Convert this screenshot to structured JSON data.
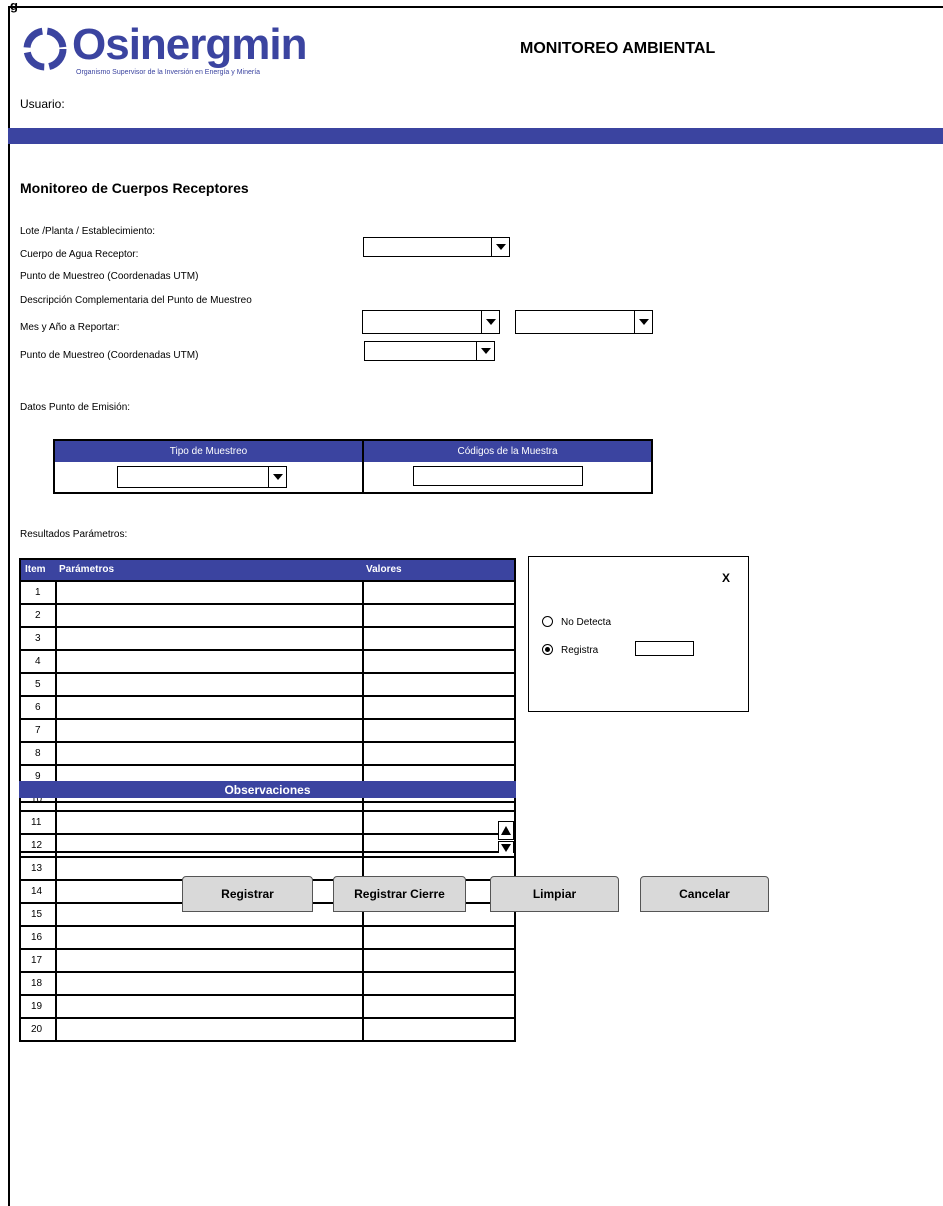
{
  "header": {
    "corner_text": "g",
    "logo_name": "Osinergmin",
    "logo_subtitle": "Organismo Supervisor de la Inversión en Energía y Minería",
    "title": "MONITOREO AMBIENTAL",
    "user_label": "Usuario:",
    "colors": {
      "brand": "#3b44a0"
    }
  },
  "form": {
    "section_title": "Monitoreo de Cuerpos Receptores",
    "labels": {
      "lote": "Lote /Planta / Establecimiento:",
      "cuerpo_agua": "Cuerpo de Agua Receptor:",
      "punto_utm_1": "Punto de Muestreo (Coordenadas UTM)",
      "descripcion": "Descripción Complementaria del Punto de Muestreo",
      "mes_anio": "Mes y Año a Reportar:",
      "punto_utm_2": "Punto de Muestreo (Coordenadas UTM)",
      "datos_emision": "Datos Punto de Emisión:",
      "resultados": "Resultados Parámetros:"
    },
    "selects": {
      "cuerpo_agua": "",
      "mes": "",
      "anio": "",
      "punto_utm": "",
      "tipo_muestreo": ""
    }
  },
  "muestra_table": {
    "headers": [
      "Tipo de Muestreo",
      "Códigos de la Muestra"
    ],
    "codigo_value": ""
  },
  "param_table": {
    "headers": {
      "item": "Item",
      "parametros": "Parámetros",
      "valores": "Valores"
    },
    "rows": [
      "1",
      "2",
      "3",
      "4",
      "5",
      "6",
      "7",
      "8",
      "9",
      "10",
      "11",
      "12",
      "13",
      "14",
      "15",
      "16",
      "17",
      "18",
      "19",
      "20"
    ]
  },
  "popup": {
    "close_label": "X",
    "option_no_detecta": "No Detecta",
    "option_registra": "Registra",
    "selected": "Registra",
    "registra_value": ""
  },
  "observaciones": {
    "header": "Observaciones",
    "value": ""
  },
  "buttons": {
    "registrar": "Registrar",
    "registrar_cierre": "Registrar Cierre",
    "limpiar": "Limpiar",
    "cancelar": "Cancelar"
  }
}
